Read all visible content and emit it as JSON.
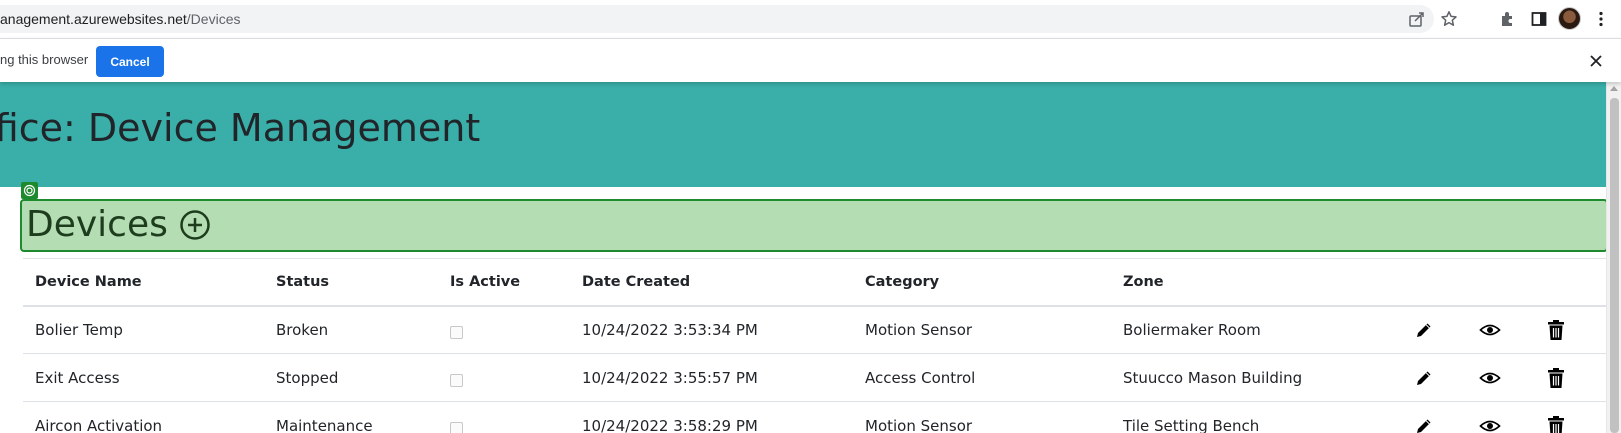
{
  "browser": {
    "url_host": "anagement.azurewebsites.net",
    "url_path": "/Devices",
    "toolbar_icons": [
      "share-icon",
      "star-icon",
      "extensions-icon",
      "side-panel-icon",
      "profile-avatar",
      "more-vert-icon"
    ]
  },
  "infobar": {
    "text": "ng this browser",
    "cancel_label": "Cancel"
  },
  "page": {
    "header_title": "ffice: Device Management",
    "section_title": "Devices",
    "colors": {
      "header_band": "#3aafa9",
      "section_band": "#b4ddb4",
      "section_border": "#1e8a2e",
      "primary_button": "#1a73e8"
    }
  },
  "table": {
    "columns": [
      "Device Name",
      "Status",
      "Is Active",
      "Date Created",
      "Category",
      "Zone"
    ],
    "rows": [
      {
        "device_name": "Bolier Temp",
        "status": "Broken",
        "is_active": false,
        "date_created": "10/24/2022 3:53:34 PM",
        "category": "Motion Sensor",
        "zone": "Boliermaker Room"
      },
      {
        "device_name": "Exit Access",
        "status": "Stopped",
        "is_active": false,
        "date_created": "10/24/2022 3:55:57 PM",
        "category": "Access Control",
        "zone": "Stuucco Mason Building"
      },
      {
        "device_name": "Aircon Activation",
        "status": "Maintenance",
        "is_active": false,
        "date_created": "10/24/2022 3:58:29 PM",
        "category": "Motion Sensor",
        "zone": "Tile Setting Bench"
      }
    ],
    "row_actions": [
      "pencil-icon",
      "eye-icon",
      "trash-icon"
    ]
  }
}
